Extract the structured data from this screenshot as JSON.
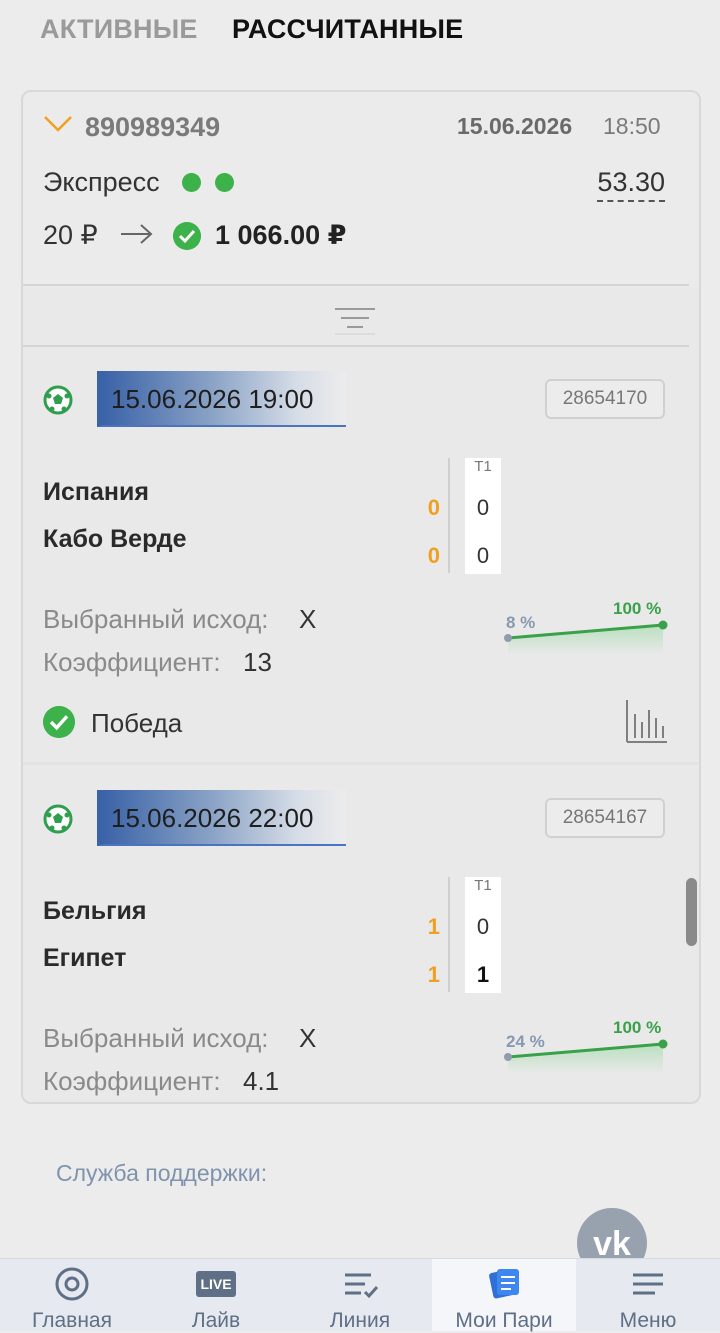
{
  "tabs": [
    {
      "label": "АКТИВНЫЕ",
      "active": false
    },
    {
      "label": "РАССЧИТАННЫЕ",
      "active": true
    }
  ],
  "bet": {
    "id": "890989349",
    "date": "15.06.2026",
    "time": "18:50",
    "type": "Экспресс",
    "coefficient": "53.30",
    "stake": "20 ₽",
    "payout": "1 066.00 ₽",
    "colors": {
      "win": "#3db24a",
      "accent": "#f0a020"
    }
  },
  "events": [
    {
      "datetime": "15.06.2026 19:00",
      "event_id": "28654170",
      "team1": "Испания",
      "team2": "Кабо Верде",
      "score1": "0",
      "score2": "0",
      "period_label": "Т1",
      "period1": "0",
      "period2": "0",
      "outcome_label": "Выбранный исход:",
      "outcome_value": "X",
      "coef_label": "Коэффициент:",
      "coef_value": "13",
      "pct_start": "8 %",
      "pct_end": "100 %",
      "result": "Победа"
    },
    {
      "datetime": "15.06.2026 22:00",
      "event_id": "28654167",
      "team1": "Бельгия",
      "team2": "Египет",
      "score1": "1",
      "score2": "1",
      "period_label": "Т1",
      "period1": "0",
      "period2": "1",
      "outcome_label": "Выбранный исход:",
      "outcome_value": "X",
      "coef_label": "Коэффициент:",
      "coef_value": "4.1",
      "pct_start": "24 %",
      "pct_end": "100 %"
    }
  ],
  "support_label": "Служба поддержки:",
  "nav": [
    {
      "label": "Главная",
      "icon": "home-icon"
    },
    {
      "label": "Лайв",
      "icon": "live-icon",
      "badge": "LIVE"
    },
    {
      "label": "Линия",
      "icon": "line-icon"
    },
    {
      "label": "Мои Пари",
      "icon": "my-bets-icon",
      "active": true
    },
    {
      "label": "Меню",
      "icon": "menu-icon"
    }
  ]
}
